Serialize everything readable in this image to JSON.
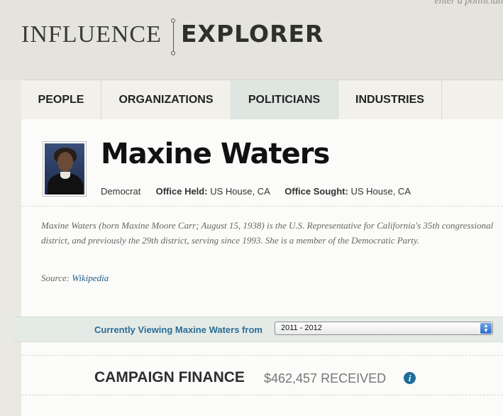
{
  "header": {
    "search_hint": "enter a politician",
    "logo_left": "INFLUENCE",
    "logo_right": "EXPLORER"
  },
  "nav": {
    "tabs": [
      {
        "label": "PEOPLE",
        "active": false
      },
      {
        "label": "ORGANIZATIONS",
        "active": false
      },
      {
        "label": "POLITICIANS",
        "active": true
      },
      {
        "label": "INDUSTRIES",
        "active": false
      }
    ]
  },
  "politician": {
    "name": "Maxine Waters",
    "party": "Democrat",
    "office_held_label": "Office Held:",
    "office_held": "US House, CA",
    "office_sought_label": "Office Sought:",
    "office_sought": "US House, CA",
    "bio": "Maxine Waters (born Maxine Moore Carr; August 15, 1938) is the U.S. Representative for California's 35th congressional district, and previously the 29th district, serving since 1993. She is a member of the Democratic Party.",
    "source_label": "Source:",
    "source_link": "Wikipedia"
  },
  "viewing": {
    "label": "Currently Viewing Maxine Waters from",
    "selected_cycle": "2011 - 2012"
  },
  "campaign_finance": {
    "title": "CAMPAIGN FINANCE",
    "amount": "$462,457 RECEIVED",
    "info_icon": "info-icon"
  },
  "colors": {
    "link": "#1f5f8b",
    "viewing_label": "#2b6c95",
    "active_tab": "#dfe6e1"
  }
}
